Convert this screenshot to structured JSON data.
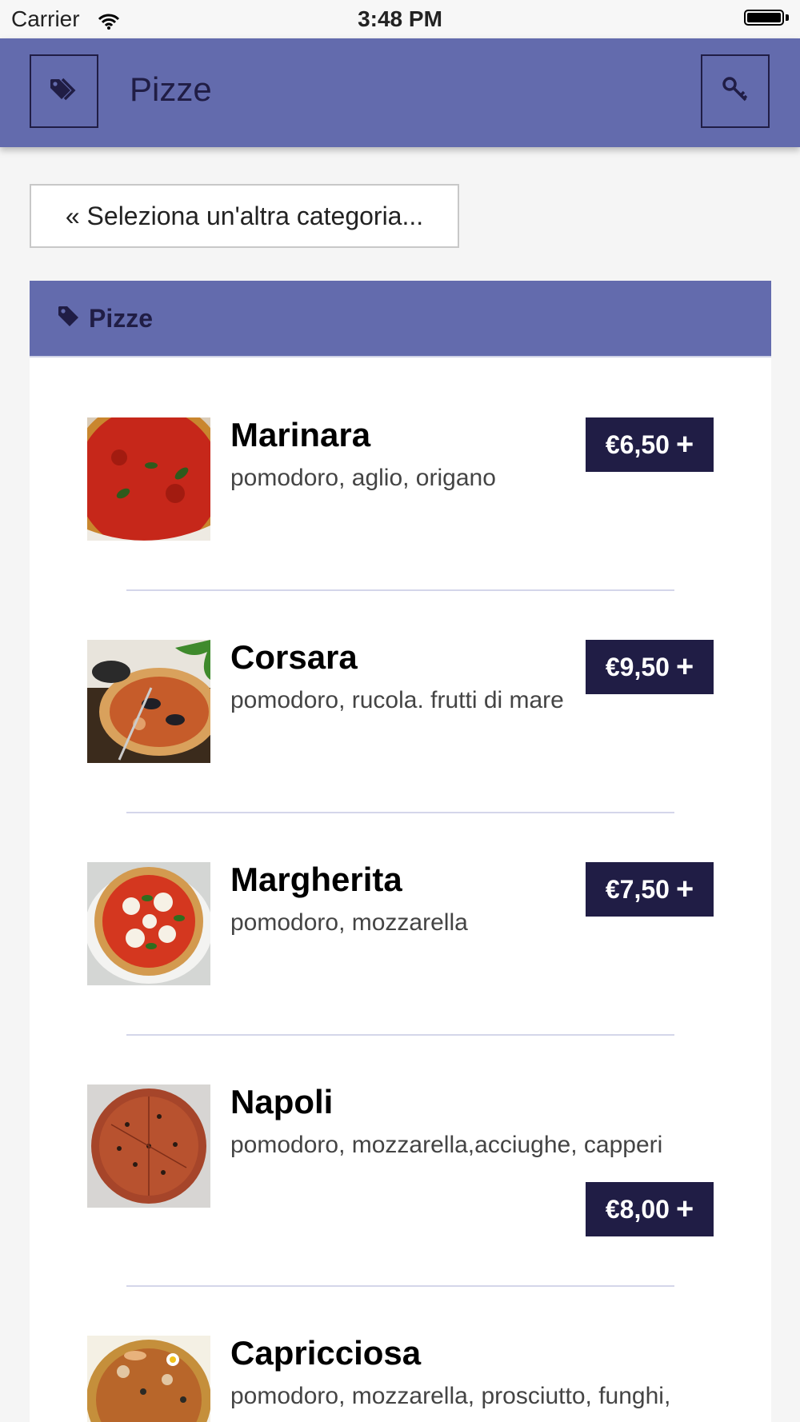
{
  "status_bar": {
    "carrier": "Carrier",
    "time": "3:48 PM"
  },
  "nav": {
    "title": "Pizze",
    "left_icon": "tags-icon",
    "right_icon": "key-icon"
  },
  "back_button": {
    "label": "« Seleziona un'altra categoria..."
  },
  "category": {
    "label": "Pizze",
    "icon": "tag-icon"
  },
  "items": [
    {
      "name": "Marinara",
      "desc": "pomodoro, aglio, origano",
      "price": "€6,50"
    },
    {
      "name": "Corsara",
      "desc": "pomodoro, rucola. frutti di mare",
      "price": "€9,50"
    },
    {
      "name": "Margherita",
      "desc": "pomodoro, mozzarella",
      "price": "€7,50"
    },
    {
      "name": "Napoli",
      "desc": "pomodoro, mozzarella,acciughe, capperi",
      "price": "€8,00"
    },
    {
      "name": "Capricciosa",
      "desc": "pomodoro, mozzarella, prosciutto, funghi,"
    }
  ],
  "colors": {
    "accent": "#636bad",
    "dark": "#201d45"
  }
}
